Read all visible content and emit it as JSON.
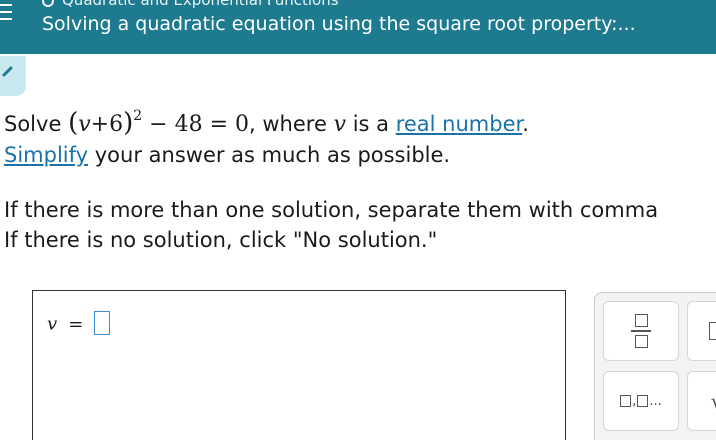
{
  "header": {
    "breadcrumb": "Quadratic and Exponential Functions",
    "title": "Solving a quadratic equation using the square root property:..."
  },
  "question": {
    "solve_word": "Solve",
    "equation_open": "(",
    "equation_var": "v",
    "equation_plus": "+6",
    "equation_close": ")",
    "equation_power": "2",
    "equation_rest": " − 48 = 0",
    "where_text": ", where",
    "var_inline": "v",
    "is_a_text": "is a",
    "real_number_link": "real number",
    "period": ".",
    "simplify_link": "Simplify",
    "simplify_rest": " your answer as much as possible.",
    "instruction_1": "If there is more than one solution, separate them with comma",
    "instruction_2": "If there is no solution, click \"No solution.\""
  },
  "answer": {
    "variable": "v",
    "equals": "=",
    "value": ""
  },
  "keypad": {
    "keys": [
      "fraction-key",
      "box-key",
      "list-key",
      "sqrt-key"
    ],
    "list_ellipsis": "...",
    "sqrt_symbol": "√"
  },
  "colors": {
    "header_bg": "#1e7a8f",
    "link": "#1a73a8",
    "input_border": "#3b8fd6",
    "check_tab": "#c9e8ef"
  }
}
